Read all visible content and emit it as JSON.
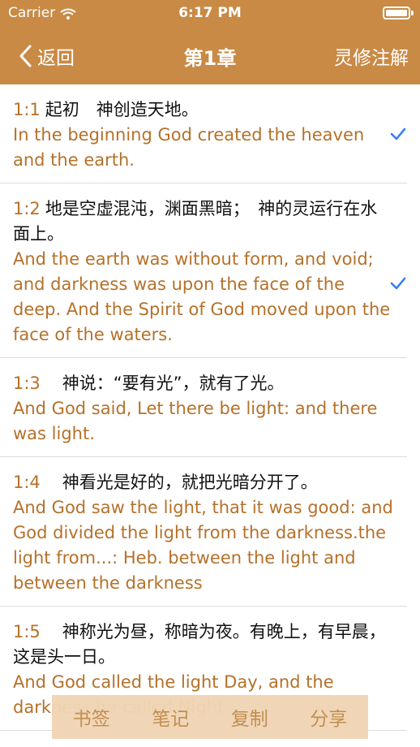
{
  "status": {
    "carrier": "Carrier",
    "time": "6:17 PM"
  },
  "nav": {
    "back_label": "返回",
    "title": "第1章",
    "right_label": "灵修注解"
  },
  "verses": [
    {
      "ref": "1:1",
      "cn": "起初　神创造天地。",
      "en": "In the beginning God created the heaven and the earth.",
      "checked": true
    },
    {
      "ref": "1:2",
      "cn": "地是空虚混沌，渊面黑暗；　神的灵运行在水面上。",
      "en": "And the earth was without form, and void; and darkness was upon the face of the deep. And the Spirit of God moved upon the face of the waters.",
      "checked": true
    },
    {
      "ref": "1:3",
      "cn": "　神说：“要有光”，就有了光。",
      "en": "And God said, Let there be light: and there was light.",
      "checked": false
    },
    {
      "ref": "1:4",
      "cn": "　神看光是好的，就把光暗分开了。",
      "en": "And God saw the light, that it was good: and God divided the light from the darkness.the light from...: Heb. between the light and between the darkness",
      "checked": false
    },
    {
      "ref": "1:5",
      "cn": "　神称光为昼，称暗为夜。有晚上，有早晨，这是头一日。",
      "en": "And God called the light Day, and the darkness he called Night.",
      "checked": false
    }
  ],
  "actions": {
    "bookmark": "书签",
    "note": "笔记",
    "copy": "复制",
    "share": "分享"
  },
  "colors": {
    "header": "#c98a45",
    "accent": "#b5712a",
    "check": "#2f7cf6"
  }
}
